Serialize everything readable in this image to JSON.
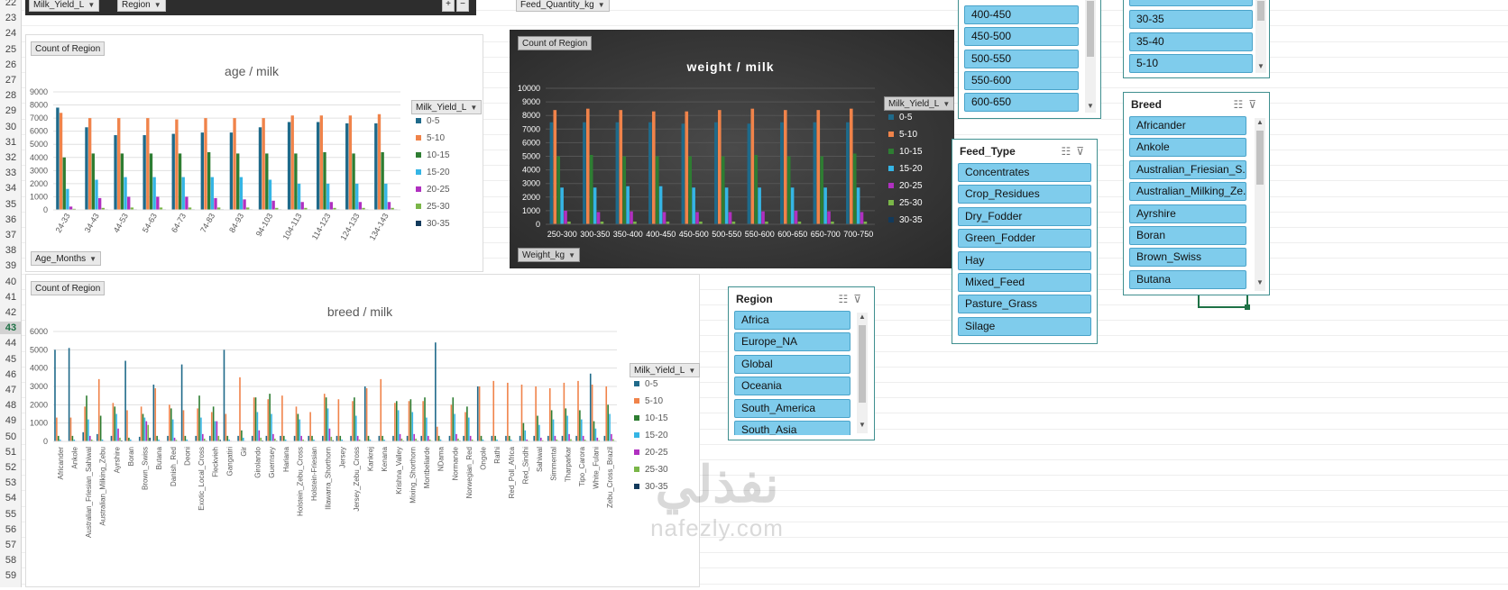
{
  "row_numbers": [
    "22",
    "23",
    "24",
    "25",
    "26",
    "27",
    "28",
    "29",
    "30",
    "31",
    "32",
    "33",
    "34",
    "35",
    "36",
    "37",
    "38",
    "39",
    "40",
    "41",
    "42",
    "43",
    "44",
    "45",
    "46",
    "47",
    "48",
    "49",
    "50",
    "51",
    "52",
    "53",
    "54",
    "55",
    "56",
    "57",
    "58",
    "59"
  ],
  "colors": {
    "s0": "#1f6a8a",
    "s1": "#f0834a",
    "s2": "#2e7d32",
    "s3": "#35b5e5",
    "s4": "#b030c0",
    "s5": "#7ab648",
    "s6": "#123a5c",
    "slicer_item": "#7fccec",
    "slicer_border": "#3f8f8f"
  },
  "top_fields": {
    "milk_yield": "Milk_Yield_L",
    "region": "Region",
    "feed_quantity": "Feed_Quantity_kg"
  },
  "chart_age": {
    "count_label": "Count of Region",
    "axis_field": "Age_Months",
    "legend_field": "Milk_Yield_L"
  },
  "chart_weight": {
    "count_label": "Count of Region",
    "axis_field": "Weight_kg",
    "legend_field": "Milk_Yield_L"
  },
  "chart_breed": {
    "count_label": "Count of Region",
    "legend_field": "Milk_Yield_L"
  },
  "chart_data": [
    {
      "type": "bar",
      "title": "age / milk",
      "categories": [
        "24-33",
        "34-43",
        "44-53",
        "54-63",
        "64-73",
        "74-83",
        "84-93",
        "94-103",
        "104-113",
        "114-123",
        "124-133",
        "134-143"
      ],
      "ylim": [
        0,
        9000
      ],
      "yticks": [
        0,
        1000,
        2000,
        3000,
        4000,
        5000,
        6000,
        7000,
        8000,
        9000
      ],
      "legend_position": "right",
      "series": [
        {
          "name": "0-5",
          "values": [
            7800,
            6300,
            5700,
            5700,
            5800,
            5900,
            5900,
            6300,
            6700,
            6700,
            6600,
            6600
          ]
        },
        {
          "name": "5-10",
          "values": [
            7400,
            7000,
            7000,
            7000,
            6900,
            7000,
            7000,
            7000,
            7200,
            7200,
            7200,
            7300
          ]
        },
        {
          "name": "10-15",
          "values": [
            4000,
            4300,
            4300,
            4300,
            4300,
            4400,
            4300,
            4300,
            4300,
            4400,
            4300,
            4400
          ]
        },
        {
          "name": "15-20",
          "values": [
            1600,
            2300,
            2500,
            2500,
            2500,
            2500,
            2500,
            2300,
            2000,
            2000,
            2000,
            2000
          ]
        },
        {
          "name": "20-25",
          "values": [
            250,
            900,
            1000,
            1000,
            1000,
            900,
            800,
            700,
            600,
            600,
            600,
            600
          ]
        },
        {
          "name": "25-30",
          "values": [
            80,
            150,
            180,
            180,
            180,
            180,
            180,
            150,
            150,
            150,
            150,
            150
          ]
        },
        {
          "name": "30-35",
          "values": [
            20,
            40,
            40,
            40,
            40,
            40,
            40,
            40,
            40,
            40,
            40,
            40
          ]
        }
      ]
    },
    {
      "type": "bar",
      "title": "weight / milk",
      "categories": [
        "250-300",
        "300-350",
        "350-400",
        "400-450",
        "450-500",
        "500-550",
        "550-600",
        "600-650",
        "650-700",
        "700-750"
      ],
      "ylim": [
        0,
        10000
      ],
      "yticks": [
        0,
        1000,
        2000,
        3000,
        4000,
        5000,
        6000,
        7000,
        8000,
        9000,
        10000
      ],
      "legend_position": "right",
      "series": [
        {
          "name": "0-5",
          "values": [
            7500,
            7500,
            7500,
            7500,
            7400,
            7500,
            7400,
            7500,
            7500,
            7500
          ]
        },
        {
          "name": "5-10",
          "values": [
            8400,
            8500,
            8400,
            8300,
            8300,
            8400,
            8500,
            8400,
            8400,
            8500
          ]
        },
        {
          "name": "10-15",
          "values": [
            5000,
            5100,
            5000,
            5000,
            5000,
            5000,
            5100,
            5000,
            5000,
            5200
          ]
        },
        {
          "name": "15-20",
          "values": [
            2700,
            2700,
            2800,
            2800,
            2700,
            2700,
            2700,
            2700,
            2700,
            2700
          ]
        },
        {
          "name": "20-25",
          "values": [
            1000,
            900,
            950,
            900,
            900,
            900,
            950,
            1000,
            950,
            900
          ]
        },
        {
          "name": "25-30",
          "values": [
            200,
            200,
            200,
            200,
            200,
            200,
            200,
            200,
            200,
            200
          ]
        },
        {
          "name": "30-35",
          "values": [
            30,
            30,
            30,
            30,
            30,
            30,
            30,
            30,
            30,
            30
          ]
        }
      ]
    },
    {
      "type": "bar",
      "title": "breed / milk",
      "categories": [
        "Africander",
        "Ankole",
        "Australian_Friesian_Sahiwal",
        "Australian_Milking_Zebu",
        "Ayrshire",
        "Boran",
        "Brown_Swiss",
        "Butana",
        "Danish_Red",
        "Deoni",
        "Exotic_Local_Cross",
        "Fleckvieh",
        "Gangatiri",
        "Gir",
        "Girolando",
        "Guernsey",
        "Hariana",
        "Holstein_Zebu_Cross",
        "Holstein-Friesian",
        "Illawarra_Shorthorn",
        "Jersey",
        "Jersey_Zebu_Cross",
        "Kankrej",
        "Kenana",
        "Krishna_Valley",
        "Mixing_Shorthorn",
        "Montbeliarde",
        "NDama",
        "Normande",
        "Norwegian_Red",
        "Ongole",
        "Rathi",
        "Red_Poll_Africa",
        "Red_Sindhi",
        "Sahiwal",
        "Simmental",
        "Tharparkar",
        "Tipo_Carora",
        "White_Fulani",
        "Zebu_Cross_Brazil"
      ],
      "ylim": [
        0,
        6000
      ],
      "yticks": [
        0,
        1000,
        2000,
        3000,
        4000,
        5000,
        6000
      ],
      "legend_position": "right",
      "series": [
        {
          "name": "0-5",
          "values": [
            5000,
            5100,
            500,
            400,
            300,
            4400,
            250,
            3100,
            300,
            4200,
            300,
            300,
            5000,
            300,
            300,
            300,
            300,
            300,
            300,
            300,
            300,
            300,
            3000,
            300,
            300,
            300,
            300,
            5400,
            300,
            300,
            3000,
            300,
            300,
            300,
            300,
            300,
            300,
            300,
            3700,
            300
          ]
        },
        {
          "name": "5-10",
          "values": [
            1300,
            1300,
            1900,
            3400,
            2100,
            1700,
            1900,
            2900,
            2000,
            1700,
            1800,
            1600,
            1500,
            3500,
            2400,
            2300,
            2500,
            1900,
            1600,
            2600,
            2300,
            2200,
            2900,
            3400,
            2100,
            2200,
            2200,
            800,
            2000,
            1600,
            3000,
            3300,
            3200,
            3100,
            3000,
            2900,
            3200,
            3300,
            3100,
            3000
          ]
        },
        {
          "name": "10-15",
          "values": [
            300,
            300,
            2500,
            1400,
            1900,
            200,
            1500,
            300,
            1800,
            300,
            2500,
            1900,
            300,
            600,
            2400,
            2600,
            300,
            1500,
            300,
            2400,
            300,
            2400,
            300,
            300,
            2200,
            2300,
            2400,
            300,
            2400,
            1900,
            300,
            300,
            300,
            1000,
            1400,
            1700,
            1800,
            1700,
            1100,
            2000
          ]
        },
        {
          "name": "15-20",
          "values": [
            100,
            100,
            1200,
            100,
            1500,
            100,
            1300,
            100,
            1200,
            100,
            1300,
            1100,
            100,
            200,
            1600,
            1500,
            100,
            1200,
            100,
            1800,
            100,
            1400,
            100,
            100,
            1700,
            1600,
            1300,
            100,
            1500,
            1300,
            100,
            100,
            100,
            600,
            900,
            1200,
            1400,
            1200,
            700,
            1500
          ]
        },
        {
          "name": "20-25",
          "values": [
            30,
            30,
            300,
            30,
            700,
            30,
            1100,
            30,
            200,
            30,
            400,
            1100,
            30,
            30,
            600,
            400,
            30,
            300,
            30,
            700,
            30,
            300,
            30,
            30,
            400,
            400,
            300,
            30,
            400,
            300,
            30,
            30,
            30,
            100,
            200,
            300,
            400,
            300,
            200,
            400
          ]
        },
        {
          "name": "25-30",
          "values": [
            10,
            10,
            100,
            10,
            200,
            10,
            900,
            10,
            80,
            10,
            150,
            300,
            10,
            10,
            200,
            150,
            10,
            100,
            10,
            250,
            10,
            100,
            10,
            10,
            150,
            150,
            100,
            10,
            150,
            100,
            10,
            10,
            10,
            40,
            60,
            100,
            120,
            100,
            60,
            120
          ]
        },
        {
          "name": "30-35",
          "values": [
            5,
            5,
            30,
            5,
            50,
            5,
            200,
            5,
            20,
            5,
            40,
            80,
            5,
            5,
            50,
            40,
            5,
            30,
            5,
            60,
            5,
            30,
            5,
            5,
            40,
            40,
            30,
            5,
            40,
            30,
            5,
            5,
            5,
            10,
            20,
            30,
            30,
            30,
            20,
            30
          ]
        }
      ]
    }
  ],
  "slicer_weight": {
    "items": [
      "400-450",
      "450-500",
      "500-550",
      "550-600",
      "600-650"
    ]
  },
  "slicer_age": {
    "items": [
      "30-35",
      "35-40",
      "5-10"
    ]
  },
  "slicer_feed_type": {
    "title": "Feed_Type",
    "items": [
      "Concentrates",
      "Crop_Residues",
      "Dry_Fodder",
      "Green_Fodder",
      "Hay",
      "Mixed_Feed",
      "Pasture_Grass",
      "Silage"
    ]
  },
  "slicer_region": {
    "title": "Region",
    "items": [
      "Africa",
      "Europe_NA",
      "Global",
      "Oceania",
      "South_America",
      "South_Asia"
    ]
  },
  "slicer_breed": {
    "title": "Breed",
    "items": [
      "Africander",
      "Ankole",
      "Australian_Friesian_S...",
      "Australian_Milking_Ze...",
      "Ayrshire",
      "Boran",
      "Brown_Swiss",
      "Butana"
    ]
  },
  "watermark": {
    "arabic": "نفذلي",
    "latin": "nafezly.com"
  }
}
